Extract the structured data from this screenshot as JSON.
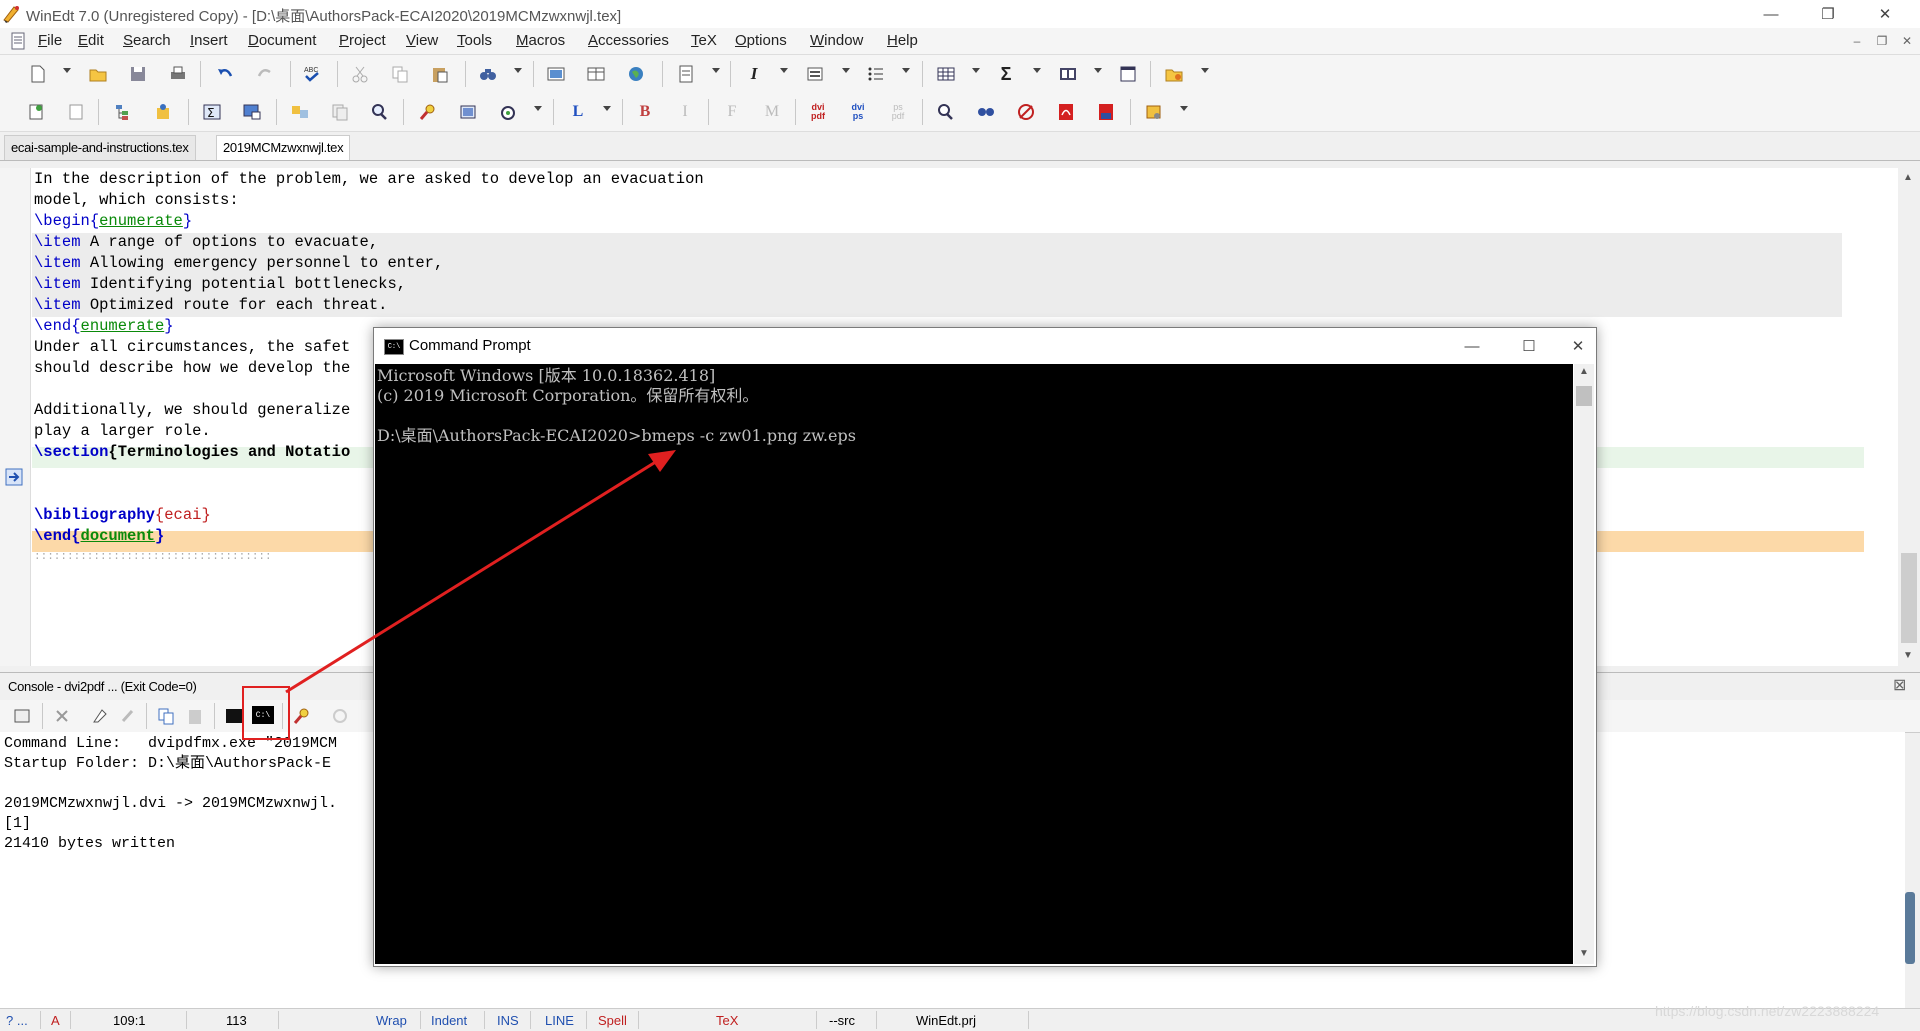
{
  "window": {
    "title": "WinEdt 7.0 (Unregistered Copy) - [D:\\桌面\\AuthorsPack-ECAI2020\\2019MCMzwxnwjl.tex]",
    "minimize": "—",
    "restore": "❐",
    "close": "✕"
  },
  "menubar": {
    "items": [
      "File",
      "Edit",
      "Search",
      "Insert",
      "Document",
      "Project",
      "View",
      "Tools",
      "Macros",
      "Accessories",
      "TeX",
      "Options",
      "Window",
      "Help"
    ],
    "mdi_minimize": "‒",
    "mdi_restore": "❐",
    "mdi_close": "✕"
  },
  "toolbar1": {
    "icons": [
      "new-file-icon",
      "open-folder-icon",
      "save-icon",
      "print-icon",
      "undo-icon",
      "redo-icon",
      "spell-check-icon",
      "cut-icon",
      "copy-icon",
      "paste-icon",
      "find-icon",
      "image-icon",
      "table-icon",
      "globe-icon",
      "document-icon",
      "italic-icon",
      "list-icon",
      "bullet-list-icon",
      "grid-table-icon",
      "sigma-icon",
      "book-icon",
      "window-icon",
      "folder-open-icon"
    ],
    "italic": "I",
    "sigma": "Σ"
  },
  "toolbar2": {
    "bold": "B",
    "italic": "I",
    "L": "L",
    "F": "F",
    "M": "M",
    "dvi_pdf": [
      "dvi",
      "pdf"
    ],
    "dvi_ps": [
      "dvi",
      "ps"
    ],
    "ps_pdf": [
      "ps",
      "pdf"
    ]
  },
  "tabs": [
    "ecai-sample-and-instructions.tex",
    "2019MCMzwxnwjl.tex"
  ],
  "editor": {
    "lines": [
      {
        "text": "In the description of the problem, we are asked to develop an evacuation"
      },
      {
        "text": "model, which consists:"
      },
      {
        "cmd": "\\begin",
        "arg": "enumerate"
      },
      {
        "cmd": "\\item",
        "text": " A range of options to evacuate,"
      },
      {
        "cmd": "\\item",
        "text": " Allowing emergency personnel to enter,"
      },
      {
        "cmd": "\\item",
        "text": " Identifying potential bottlenecks,"
      },
      {
        "cmd": "\\item",
        "text": " Optimized route for each threat."
      },
      {
        "cmd": "\\end",
        "arg": "enumerate"
      },
      {
        "text": "Under all circumstances, the safet"
      },
      {
        "text": "should describe how we develop the"
      },
      {
        "text": ""
      },
      {
        "text": "Additionally, we should generalize"
      },
      {
        "text": "play a larger role."
      },
      {
        "cmd": "\\section",
        "text": "{Terminologies and Notatio"
      },
      {
        "text": ""
      },
      {
        "text": ""
      },
      {
        "cmd": "\\bibliography",
        "arg": "ecai"
      },
      {
        "cmd": "\\end",
        "arg": "document"
      },
      {
        "text": "::::::::::::::::::::::::::::::::::::"
      }
    ]
  },
  "console": {
    "header": "Console - dvi2pdf ... (Exit Code=0)",
    "lines": [
      "Command Line:   dvipdfmx.exe \"2019MCM",
      "Startup Folder: D:\\桌面\\AuthorsPack-E",
      "",
      "2019MCMzwxnwjl.dvi -> 2019MCMzwxnwjl.",
      "[1]",
      "21410 bytes written"
    ],
    "close": "⊠"
  },
  "statusbar": {
    "help": "? ...",
    "mode": "A",
    "position": "109:1",
    "lines": "113",
    "wrap": "Wrap",
    "indent": "Indent",
    "ins": "INS",
    "line": "LINE",
    "spell": "Spell",
    "tex": "TeX",
    "src": "--src",
    "project": "WinEdt.prj"
  },
  "cmd": {
    "title": "Command Prompt",
    "icon_text": "C:\\",
    "lines": [
      "Microsoft Windows [版本 10.0.18362.418]",
      "(c) 2019 Microsoft Corporation。保留所有权利。",
      "",
      "D:\\桌面\\AuthorsPack-ECAI2020>bmeps -c zw01.png zw.eps"
    ],
    "minimize": "—",
    "maximize": "☐",
    "close": "✕"
  },
  "watermark": "https://blog.csdn.net/zw2223888224",
  "colors": {
    "accent_red": "#e02020",
    "keyword_blue": "#0000c8",
    "arg_green": "#0a8a0a",
    "highlight_orange": "#fcd9a8"
  }
}
